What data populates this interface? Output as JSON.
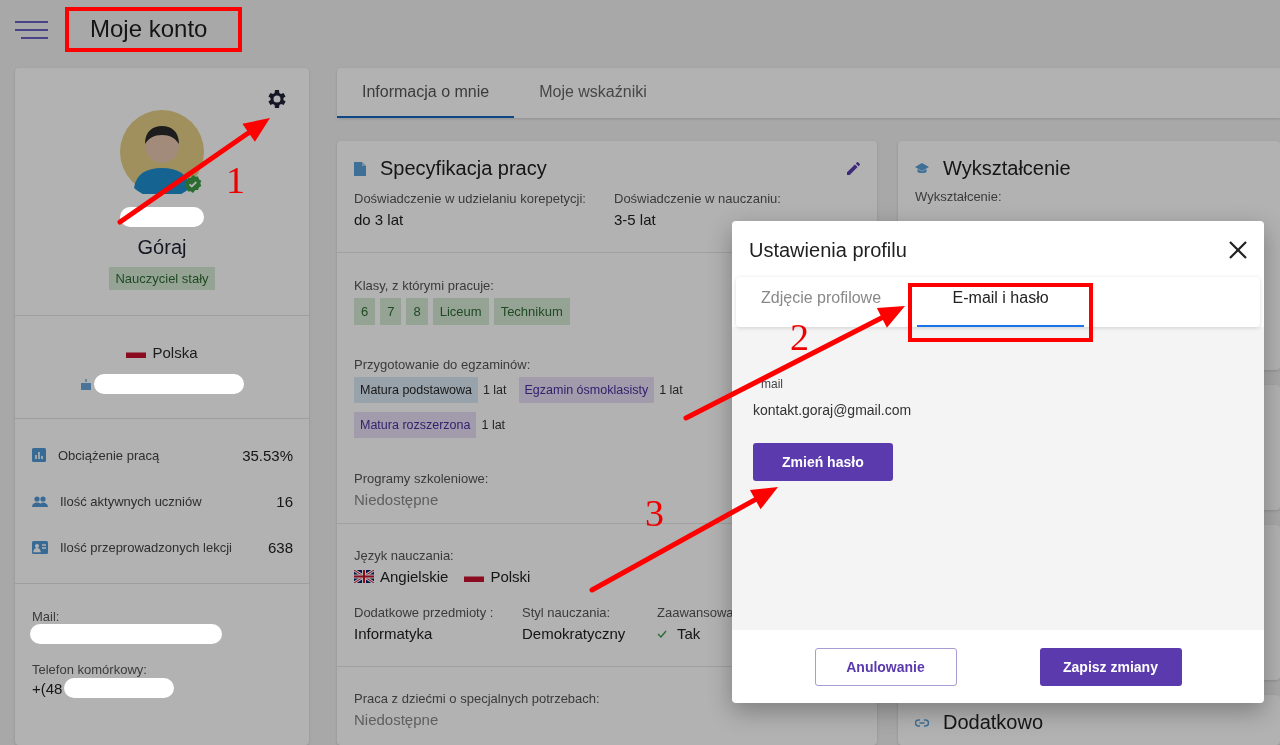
{
  "header": {
    "title": "Moje konto"
  },
  "profile": {
    "last_name": "Góraj",
    "role": "Nauczyciel stały",
    "country": {
      "name": "Polska",
      "kind": "pl"
    },
    "stats": [
      {
        "kind": "chart",
        "label": "Obciążenie pracą",
        "value": "35.53%"
      },
      {
        "kind": "people",
        "label": "Ilość aktywnych uczniów",
        "value": "16"
      },
      {
        "kind": "idcard",
        "label": "Ilość przeprowadzonych lekcji",
        "value": "638"
      }
    ],
    "mail_label": "Mail:",
    "phone_label": "Telefon komórkowy:",
    "phone_value": "+(48"
  },
  "tabs": [
    {
      "label": "Informacja o mnie",
      "selected": true
    },
    {
      "label": "Moje wskaźniki",
      "selected": false
    }
  ],
  "job_card": {
    "title": "Specyfikacja pracy",
    "experience": [
      {
        "label": "Doświadczenie w udzielaniu korepetycji:",
        "value": "do 3 lat"
      },
      {
        "label": "Doświadczenie w nauczaniu:",
        "value": "3-5 lat"
      }
    ],
    "classes_label": "Klasy, z którymi pracuje:",
    "classes": [
      "6",
      "7",
      "8",
      "Liceum",
      "Technikum"
    ],
    "exams_label": "Przygotowanie do egzaminów:",
    "exams": [
      {
        "label": "Matura podstawowa",
        "duration": "1 lat",
        "color": "#98a2aa"
      },
      {
        "label": "Egzamin ósmoklasisty",
        "duration": "1 lat",
        "color": "#a19bac"
      },
      {
        "label": "Matura rozszerzona",
        "duration": "1 lat",
        "color": "#a19bac"
      }
    ],
    "programs_label": "Programy szkoleniowe:",
    "programs_value": "Niedostępne",
    "languages_label": "Język nauczania:",
    "languages": [
      {
        "name": "Angielskie",
        "kind": "uk"
      },
      {
        "name": "Polski",
        "kind": "pl"
      }
    ],
    "details": [
      {
        "label": "Dodatkowe przedmioty :",
        "value": "Informatyka",
        "checked": false
      },
      {
        "label": "Styl nauczania:",
        "value": "Demokratyczny",
        "checked": false
      },
      {
        "label": "Zaawansowa",
        "value": "Tak",
        "checked": true
      }
    ],
    "special_label": "Praca z dziećmi o specjalnych potrzebach:",
    "special_value": "Niedostępne"
  },
  "education_card": {
    "title": "Wykształcenie",
    "field_label": "Wykształcenie:"
  },
  "extra_card": {
    "title": "Dodatkowo"
  },
  "dialog": {
    "title": "Ustawienia profilu",
    "tabs": [
      {
        "label": "Zdjęcie profilowe",
        "selected": false
      },
      {
        "label": "E-mail i hasło",
        "selected": true
      }
    ],
    "email_label": "mail",
    "email_value": "kontakt.goraj@gmail.com",
    "change_password": "Zmień hasło",
    "cancel": "Anulowanie",
    "save": "Zapisz zmiany"
  },
  "annotations": [
    {
      "kind": "box"
    },
    {
      "kind": "box"
    },
    {
      "kind": "arrow",
      "label": "1"
    },
    {
      "kind": "arrow",
      "label": "2"
    },
    {
      "kind": "arrow",
      "label": "3"
    }
  ]
}
